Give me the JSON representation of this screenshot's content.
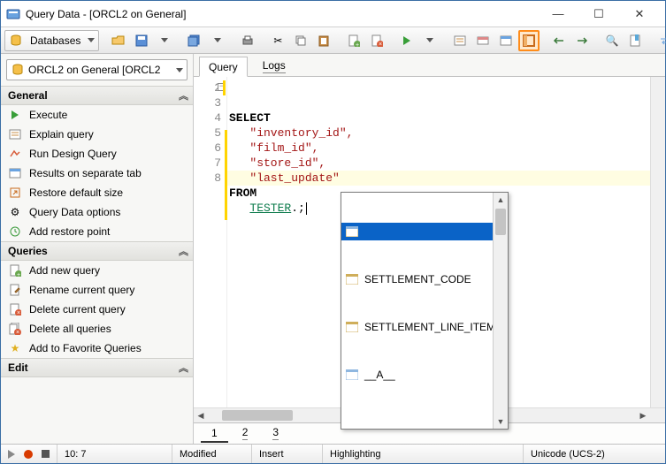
{
  "window": {
    "title": "Query Data - [ORCL2 on General]"
  },
  "toolbar": {
    "databases_label": "Databases"
  },
  "sidebar": {
    "connection": "ORCL2 on General [ORCL2",
    "sections": {
      "general": {
        "title": "General",
        "items": [
          {
            "label": "Execute"
          },
          {
            "label": "Explain query"
          },
          {
            "label": "Run Design Query"
          },
          {
            "label": "Results on separate tab"
          },
          {
            "label": "Restore default size"
          },
          {
            "label": "Query Data options"
          },
          {
            "label": "Add restore point"
          }
        ]
      },
      "queries": {
        "title": "Queries",
        "items": [
          {
            "label": "Add new query"
          },
          {
            "label": "Rename current query"
          },
          {
            "label": "Delete current query"
          },
          {
            "label": "Delete all queries"
          },
          {
            "label": "Add to Favorite Queries"
          }
        ]
      },
      "edit": {
        "title": "Edit"
      }
    }
  },
  "editor": {
    "tabs": {
      "query": "Query",
      "logs": "Logs"
    },
    "lines": {
      "l1a": "SELECT",
      "l2": "   \"inventory_id\",",
      "l3": "   \"film_id\",",
      "l4": "   \"store_id\",",
      "l5": "   \"last_update\"",
      "l6": "FROM",
      "l7a": "   ",
      "l7b": "TESTER",
      "l7c": ".;"
    },
    "gutter": [
      "",
      "2",
      "3",
      "4",
      "5",
      "6",
      "7",
      "8"
    ],
    "autocomplete": {
      "items": [
        {
          "label": ""
        },
        {
          "label": "SETTLEMENT_CODE"
        },
        {
          "label": "SETTLEMENT_LINE_ITEM"
        },
        {
          "label": "__A__"
        }
      ]
    },
    "pages": [
      "1",
      "2",
      "3"
    ]
  },
  "status": {
    "pos": "10:  7",
    "modified": "Modified",
    "insert": "Insert",
    "highlighting": "Highlighting",
    "encoding": "Unicode (UCS-2)"
  }
}
